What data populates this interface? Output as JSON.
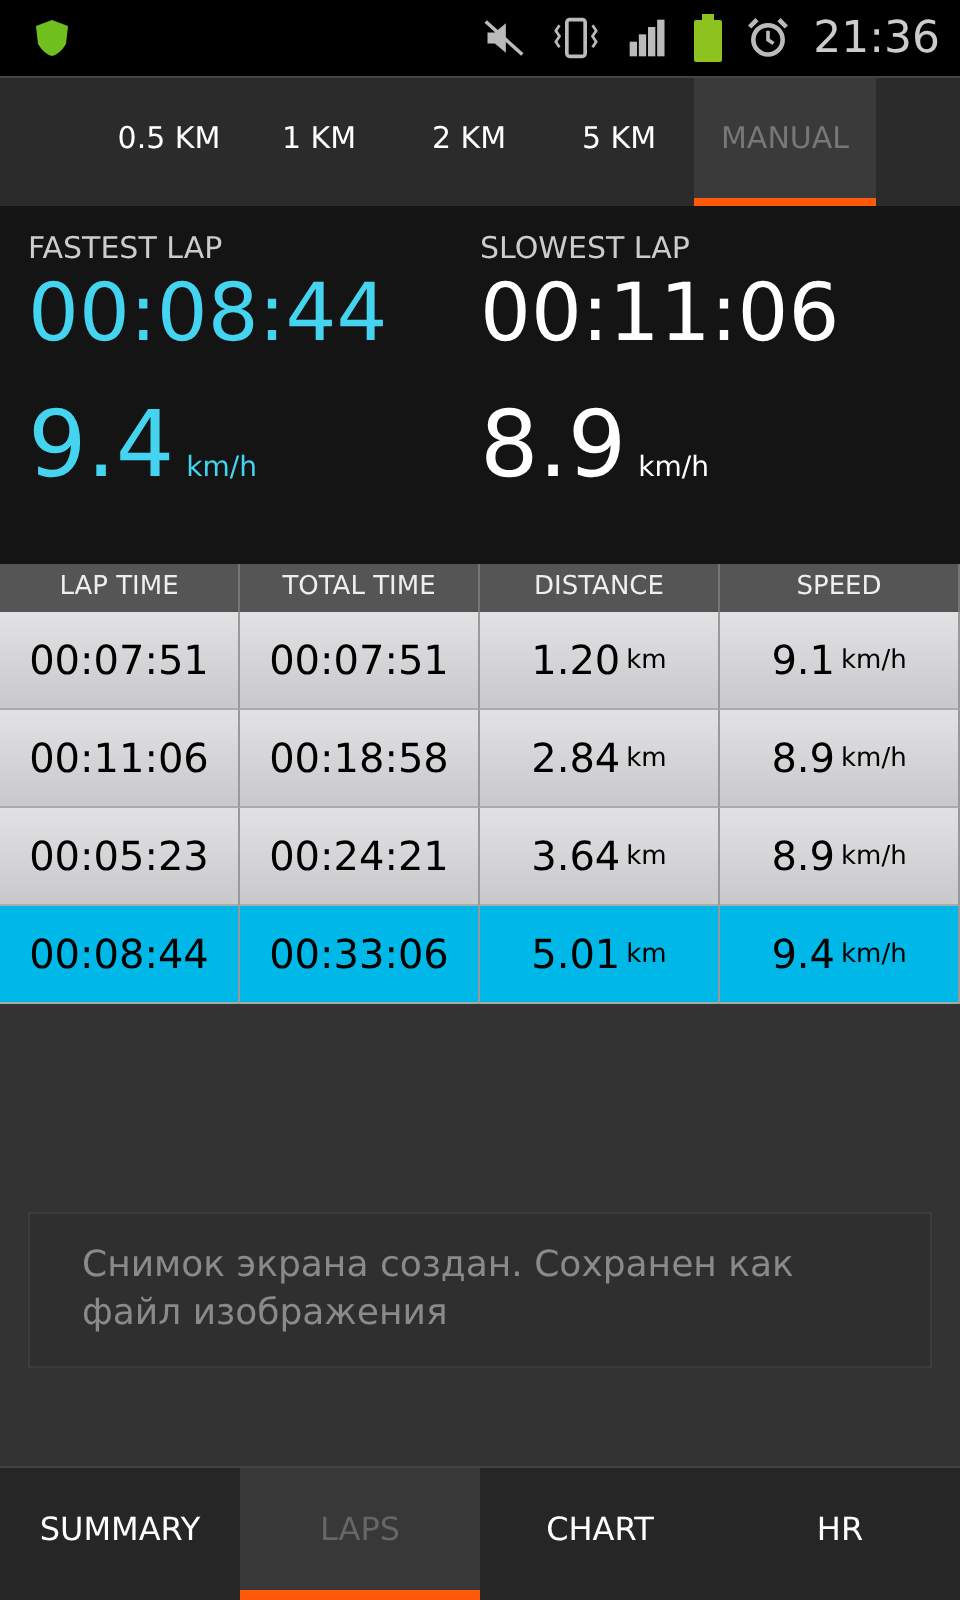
{
  "status_bar": {
    "time": "21:36"
  },
  "distance_tabs": [
    {
      "label": "0.5 KM",
      "selected": false
    },
    {
      "label": "1 KM",
      "selected": false
    },
    {
      "label": "2 KM",
      "selected": false
    },
    {
      "label": "5 KM",
      "selected": false
    },
    {
      "label": "MANUAL",
      "selected": true
    }
  ],
  "stats": [
    {
      "kind": "fastest",
      "title": "FASTEST LAP",
      "time": "00:08:44",
      "speed": "9.4",
      "unit": "km/h"
    },
    {
      "kind": "slowest",
      "title": "SLOWEST LAP",
      "time": "00:11:06",
      "speed": "8.9",
      "unit": "km/h"
    }
  ],
  "table": {
    "columns": [
      "LAP TIME",
      "TOTAL TIME",
      "DISTANCE",
      "SPEED"
    ],
    "rows": [
      {
        "lap_time": "00:07:51",
        "total_time": "00:07:51",
        "distance": "1.20",
        "distance_unit": "km",
        "speed": "9.1",
        "speed_unit": "km/h",
        "selected": false
      },
      {
        "lap_time": "00:11:06",
        "total_time": "00:18:58",
        "distance": "2.84",
        "distance_unit": "km",
        "speed": "8.9",
        "speed_unit": "km/h",
        "selected": false
      },
      {
        "lap_time": "00:05:23",
        "total_time": "00:24:21",
        "distance": "3.64",
        "distance_unit": "km",
        "speed": "8.9",
        "speed_unit": "km/h",
        "selected": false
      },
      {
        "lap_time": "00:08:44",
        "total_time": "00:33:06",
        "distance": "5.01",
        "distance_unit": "km",
        "speed": "9.4",
        "speed_unit": "km/h",
        "selected": true
      }
    ]
  },
  "toast": {
    "text": "Снимок экрана создан. Сохранен как файл изображения"
  },
  "bottom_tabs": [
    {
      "label": "SUMMARY",
      "selected": false
    },
    {
      "label": "LAPS",
      "selected": true
    },
    {
      "label": "CHART",
      "selected": false
    },
    {
      "label": "HR",
      "selected": false
    }
  ]
}
